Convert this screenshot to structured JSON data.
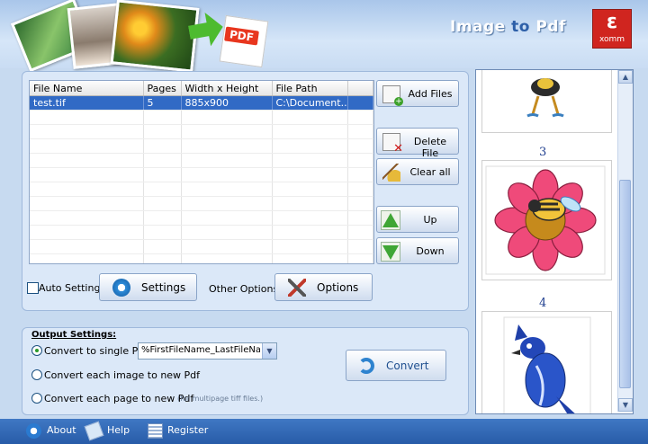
{
  "app": {
    "title_part1": "Image",
    "title_part2": " to ",
    "title_part3": "Pdf",
    "logo_symbol": "ε",
    "logo_text": "xomm",
    "banner_pdf_label": "PDF"
  },
  "file_grid": {
    "columns": [
      "File Name",
      "Pages",
      "Width x Height",
      "File Path"
    ],
    "rows": [
      {
        "file_name": "test.tif",
        "pages": "5",
        "dimensions": "885x900",
        "file_path": "C:\\Document..."
      }
    ]
  },
  "side_buttons": {
    "add_files": "Add Files",
    "delete_file": "Delete File",
    "clear_all": "Clear all",
    "up": "Up",
    "down": "Down"
  },
  "options_row": {
    "auto_settings_label": "Auto Settings",
    "auto_settings_checked": false,
    "settings_button": "Settings",
    "other_options_label": "Other Options:",
    "options_button": "Options"
  },
  "output_settings": {
    "heading": "Output Settings:",
    "single_pdf_label": "Convert to single Pdf:",
    "single_pdf_filename": "%FirstFileName_LastFileName%",
    "each_image_label": "Convert each image to new Pdf",
    "each_page_label": "Convert each page to new Pdf",
    "each_page_note": "(for multipage tiff files.)",
    "selected": "single",
    "convert_button": "Convert"
  },
  "preview": {
    "page_numbers": [
      "3",
      "4"
    ]
  },
  "status_bar": {
    "about": "About",
    "help": "Help",
    "register": "Register"
  },
  "colors": {
    "selection": "#316ac5",
    "status_bar": "#2f66b3",
    "accent_green": "#3fa635"
  }
}
